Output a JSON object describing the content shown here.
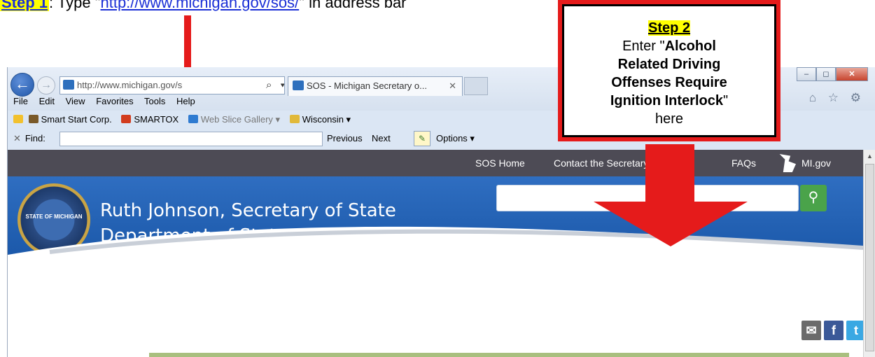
{
  "step1": {
    "tag": "Step 1",
    "text_before": ": Type \"",
    "url": "http://www.michigan.gov/sos/",
    "text_after": "\" in address bar"
  },
  "step2": {
    "tag": "Step 2",
    "line_enter": "Enter \"",
    "phrase_1": "Alcohol",
    "phrase_2": "Related Driving",
    "phrase_3": "Offenses Require",
    "phrase_4": "Ignition Interlock",
    "close_quote": "\"",
    "line_here": "here"
  },
  "browser": {
    "address": "http://www.michigan.gov/s",
    "address_tools": "⌕ ▾ ↻ ✕",
    "tab_title": "SOS - Michigan Secretary o...",
    "tab_close": "✕",
    "back": "←",
    "forward": "→",
    "win_min": "‒",
    "win_max": "◻",
    "win_close": "✕",
    "right_icons": "⌂ ☆ ⚙",
    "menu": [
      "File",
      "Edit",
      "View",
      "Favorites",
      "Tools",
      "Help"
    ],
    "favorites": [
      {
        "label": "Smart Start Corp.",
        "color": "#7a5a2a"
      },
      {
        "label": "SMARTOX",
        "color": "#d23c1e"
      },
      {
        "label": "Web Slice Gallery ▾",
        "color": "#2f7bd1"
      },
      {
        "label": "Wisconsin ▾",
        "color": "#e1b93a"
      }
    ],
    "find_close": "✕",
    "find_label": "Find:",
    "find_prev": "Previous",
    "find_next": "Next",
    "find_pencil": "✎",
    "find_options": "Options ▾"
  },
  "site": {
    "nav": {
      "home": "SOS Home",
      "contact": "Contact the Secretary of State",
      "faqs": "FAQs",
      "migov": "MI.gov"
    },
    "seal_text": "STATE OF MICHIGAN",
    "title_line1": "Ruth Johnson, Secretary of State",
    "title_line2": "Department of State",
    "search_icon": "⚲",
    "social": {
      "mail": "✉",
      "facebook": "f",
      "twitter": "t"
    }
  },
  "colors": {
    "arrow_red": "#e51b1b",
    "highlight_yellow": "#ffff00",
    "link_blue": "#1a2fd6",
    "header_blue": "#2f6ec1",
    "nav_gray": "#4d4b55",
    "search_green": "#4aa34a"
  }
}
